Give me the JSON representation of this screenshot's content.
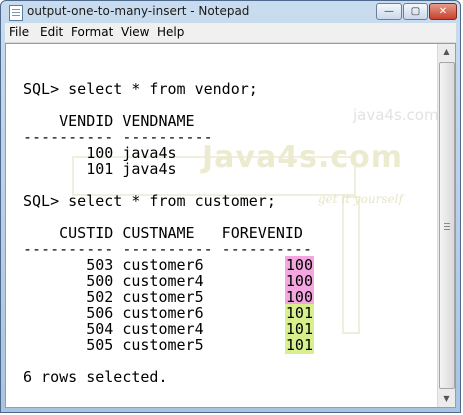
{
  "window": {
    "title": "output-one-to-many-insert - Notepad",
    "buttons": {
      "minimize": "—",
      "maximize": "▢",
      "close": "✕"
    }
  },
  "menu": [
    "File",
    "Edit",
    "Format",
    "View",
    "Help"
  ],
  "watermark": {
    "site": "java4s.com",
    "logo": "Java4s.com",
    "tagline": "get it yourself"
  },
  "content": {
    "query1": "SQL> select * from vendor;",
    "vendor_header": "    VENDID VENDNAME",
    "vendor_sep": "---------- ----------",
    "vendor_rows": [
      {
        "id": "100",
        "name": "java4s"
      },
      {
        "id": "101",
        "name": "java4s"
      }
    ],
    "query2": "SQL> select * from customer;",
    "customer_header": "    CUSTID CUSTNAME   FOREVENID",
    "customer_sep": "---------- ---------- ----------",
    "customer_rows": [
      {
        "id": "503",
        "name": "customer6",
        "fk": "100"
      },
      {
        "id": "500",
        "name": "customer4",
        "fk": "100"
      },
      {
        "id": "502",
        "name": "customer5",
        "fk": "100"
      },
      {
        "id": "506",
        "name": "customer6",
        "fk": "101"
      },
      {
        "id": "504",
        "name": "customer4",
        "fk": "101"
      },
      {
        "id": "505",
        "name": "customer5",
        "fk": "101"
      }
    ],
    "footer": "6 rows selected."
  },
  "colors": {
    "highlight_100": "#f3a6df",
    "highlight_101": "#d8ef8e"
  }
}
